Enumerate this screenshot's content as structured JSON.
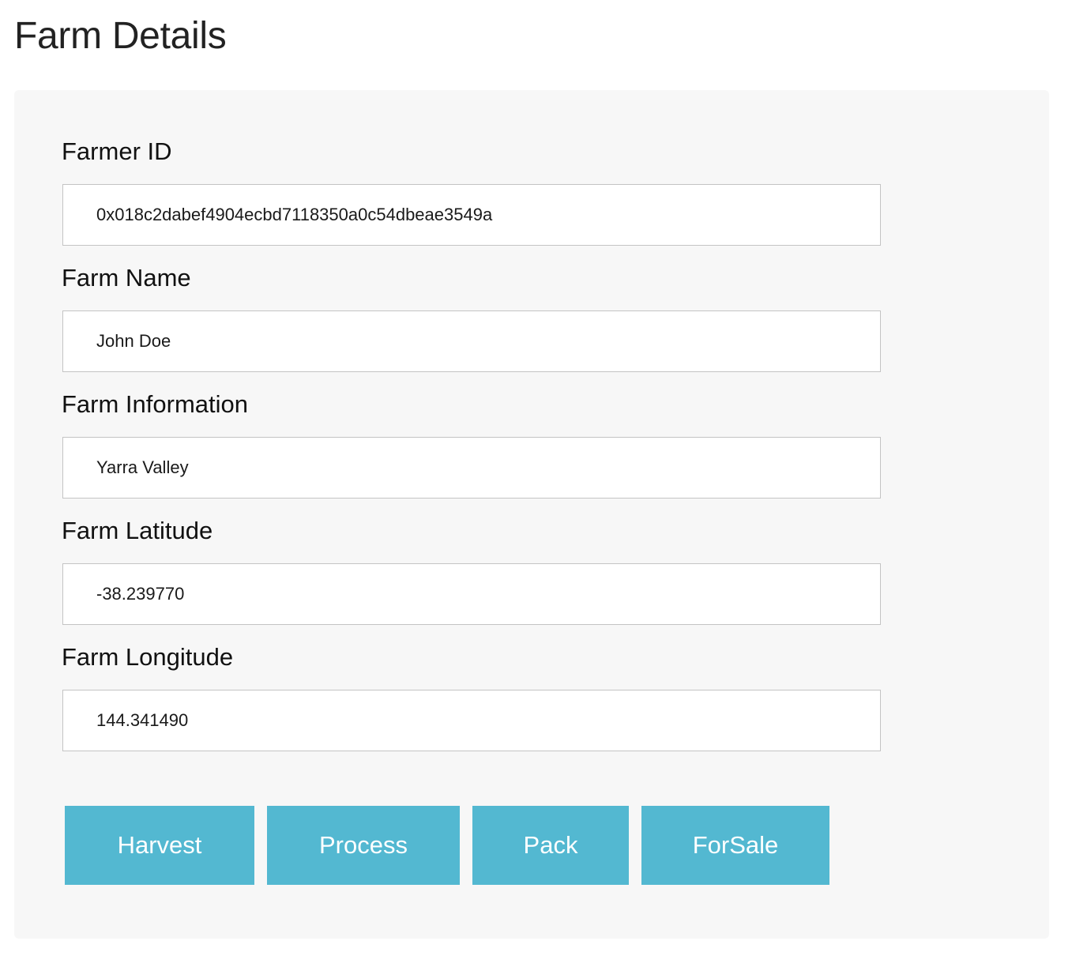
{
  "page": {
    "title": "Farm Details"
  },
  "form": {
    "fields": [
      {
        "label": "Farmer ID",
        "value": "0x018c2dabef4904ecbd7118350a0c54dbeae3549a"
      },
      {
        "label": "Farm Name",
        "value": "John Doe"
      },
      {
        "label": "Farm Information",
        "value": "Yarra Valley"
      },
      {
        "label": "Farm Latitude",
        "value": "-38.239770"
      },
      {
        "label": "Farm Longitude",
        "value": "144.341490"
      }
    ]
  },
  "actions": {
    "harvest": "Harvest",
    "process": "Process",
    "pack": "Pack",
    "forsale": "ForSale"
  },
  "colors": {
    "button_bg": "#53b8d1",
    "panel_bg": "#f7f7f7"
  }
}
